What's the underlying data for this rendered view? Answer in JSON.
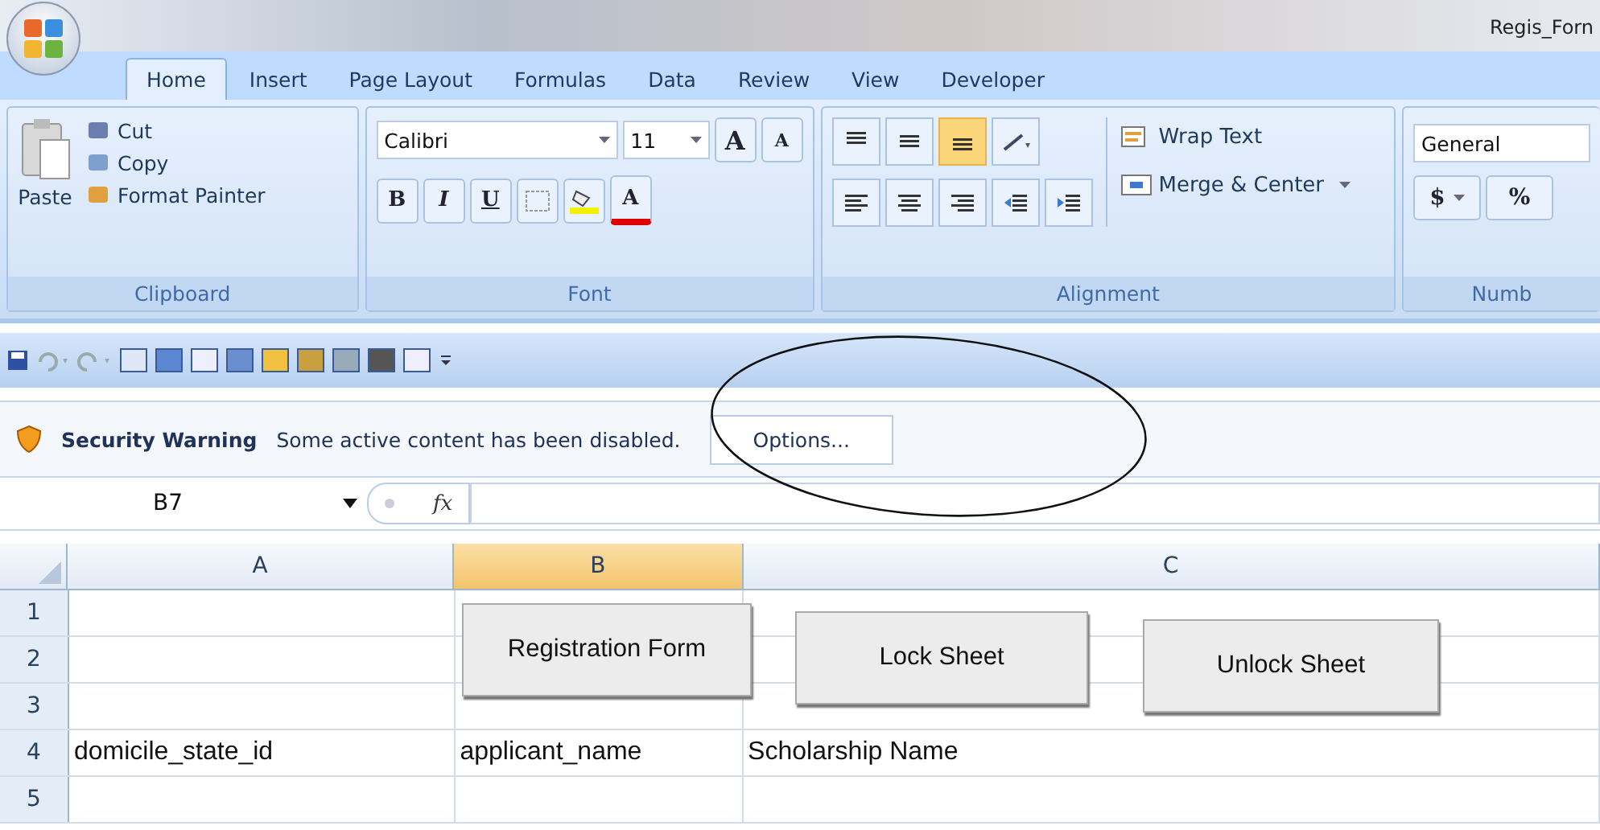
{
  "title": "Regis_Forn",
  "tabs": [
    {
      "label": "Home",
      "selected": true
    },
    {
      "label": "Insert",
      "selected": false
    },
    {
      "label": "Page Layout",
      "selected": false
    },
    {
      "label": "Formulas",
      "selected": false
    },
    {
      "label": "Data",
      "selected": false
    },
    {
      "label": "Review",
      "selected": false
    },
    {
      "label": "View",
      "selected": false
    },
    {
      "label": "Developer",
      "selected": false
    }
  ],
  "clipboard": {
    "paste": "Paste",
    "items": [
      "Cut",
      "Copy",
      "Format Painter"
    ],
    "label": "Clipboard"
  },
  "font": {
    "family": "Calibri",
    "size": "11",
    "grow": "A",
    "shrink": "A",
    "styles": [
      "B",
      "I",
      "U"
    ],
    "color_letter": "A",
    "label": "Font"
  },
  "alignment": {
    "vertical": [
      {
        "selected": false
      },
      {
        "selected": false
      },
      {
        "selected": true
      }
    ],
    "wrap": "Wrap Text",
    "merge": "Merge & Center",
    "label": "Alignment"
  },
  "number": {
    "format": "General",
    "currency": "$",
    "percent": "%",
    "label": "Numb"
  },
  "security": {
    "title": "Security Warning",
    "message": "Some active content has been disabled.",
    "button": "Options..."
  },
  "formula_bar": {
    "name_box": "B7",
    "fx": "fx"
  },
  "sheet": {
    "columns": [
      {
        "label": "A",
        "selected": false
      },
      {
        "label": "B",
        "selected": true
      },
      {
        "label": "C",
        "selected": false
      }
    ],
    "rows": [
      {
        "header": "1"
      },
      {
        "header": "2"
      },
      {
        "header": "3"
      },
      {
        "header": "4",
        "cells": [
          "domicile_state_id",
          "applicant_name",
          "Scholarship Name"
        ]
      },
      {
        "header": "5"
      }
    ],
    "buttons": [
      "Registration Form",
      "Lock Sheet",
      "Unlock Sheet"
    ]
  }
}
